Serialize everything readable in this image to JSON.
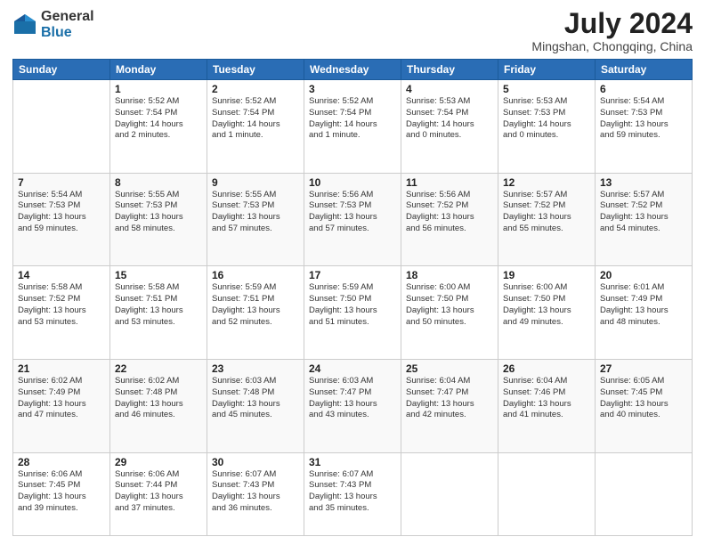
{
  "header": {
    "logo_general": "General",
    "logo_blue": "Blue",
    "month_title": "July 2024",
    "location": "Mingshan, Chongqing, China"
  },
  "days_of_week": [
    "Sunday",
    "Monday",
    "Tuesday",
    "Wednesday",
    "Thursday",
    "Friday",
    "Saturday"
  ],
  "weeks": [
    [
      {
        "day": "",
        "info": ""
      },
      {
        "day": "1",
        "info": "Sunrise: 5:52 AM\nSunset: 7:54 PM\nDaylight: 14 hours\nand 2 minutes."
      },
      {
        "day": "2",
        "info": "Sunrise: 5:52 AM\nSunset: 7:54 PM\nDaylight: 14 hours\nand 1 minute."
      },
      {
        "day": "3",
        "info": "Sunrise: 5:52 AM\nSunset: 7:54 PM\nDaylight: 14 hours\nand 1 minute."
      },
      {
        "day": "4",
        "info": "Sunrise: 5:53 AM\nSunset: 7:54 PM\nDaylight: 14 hours\nand 0 minutes."
      },
      {
        "day": "5",
        "info": "Sunrise: 5:53 AM\nSunset: 7:53 PM\nDaylight: 14 hours\nand 0 minutes."
      },
      {
        "day": "6",
        "info": "Sunrise: 5:54 AM\nSunset: 7:53 PM\nDaylight: 13 hours\nand 59 minutes."
      }
    ],
    [
      {
        "day": "7",
        "info": "Sunrise: 5:54 AM\nSunset: 7:53 PM\nDaylight: 13 hours\nand 59 minutes."
      },
      {
        "day": "8",
        "info": "Sunrise: 5:55 AM\nSunset: 7:53 PM\nDaylight: 13 hours\nand 58 minutes."
      },
      {
        "day": "9",
        "info": "Sunrise: 5:55 AM\nSunset: 7:53 PM\nDaylight: 13 hours\nand 57 minutes."
      },
      {
        "day": "10",
        "info": "Sunrise: 5:56 AM\nSunset: 7:53 PM\nDaylight: 13 hours\nand 57 minutes."
      },
      {
        "day": "11",
        "info": "Sunrise: 5:56 AM\nSunset: 7:52 PM\nDaylight: 13 hours\nand 56 minutes."
      },
      {
        "day": "12",
        "info": "Sunrise: 5:57 AM\nSunset: 7:52 PM\nDaylight: 13 hours\nand 55 minutes."
      },
      {
        "day": "13",
        "info": "Sunrise: 5:57 AM\nSunset: 7:52 PM\nDaylight: 13 hours\nand 54 minutes."
      }
    ],
    [
      {
        "day": "14",
        "info": "Sunrise: 5:58 AM\nSunset: 7:52 PM\nDaylight: 13 hours\nand 53 minutes."
      },
      {
        "day": "15",
        "info": "Sunrise: 5:58 AM\nSunset: 7:51 PM\nDaylight: 13 hours\nand 53 minutes."
      },
      {
        "day": "16",
        "info": "Sunrise: 5:59 AM\nSunset: 7:51 PM\nDaylight: 13 hours\nand 52 minutes."
      },
      {
        "day": "17",
        "info": "Sunrise: 5:59 AM\nSunset: 7:50 PM\nDaylight: 13 hours\nand 51 minutes."
      },
      {
        "day": "18",
        "info": "Sunrise: 6:00 AM\nSunset: 7:50 PM\nDaylight: 13 hours\nand 50 minutes."
      },
      {
        "day": "19",
        "info": "Sunrise: 6:00 AM\nSunset: 7:50 PM\nDaylight: 13 hours\nand 49 minutes."
      },
      {
        "day": "20",
        "info": "Sunrise: 6:01 AM\nSunset: 7:49 PM\nDaylight: 13 hours\nand 48 minutes."
      }
    ],
    [
      {
        "day": "21",
        "info": "Sunrise: 6:02 AM\nSunset: 7:49 PM\nDaylight: 13 hours\nand 47 minutes."
      },
      {
        "day": "22",
        "info": "Sunrise: 6:02 AM\nSunset: 7:48 PM\nDaylight: 13 hours\nand 46 minutes."
      },
      {
        "day": "23",
        "info": "Sunrise: 6:03 AM\nSunset: 7:48 PM\nDaylight: 13 hours\nand 45 minutes."
      },
      {
        "day": "24",
        "info": "Sunrise: 6:03 AM\nSunset: 7:47 PM\nDaylight: 13 hours\nand 43 minutes."
      },
      {
        "day": "25",
        "info": "Sunrise: 6:04 AM\nSunset: 7:47 PM\nDaylight: 13 hours\nand 42 minutes."
      },
      {
        "day": "26",
        "info": "Sunrise: 6:04 AM\nSunset: 7:46 PM\nDaylight: 13 hours\nand 41 minutes."
      },
      {
        "day": "27",
        "info": "Sunrise: 6:05 AM\nSunset: 7:45 PM\nDaylight: 13 hours\nand 40 minutes."
      }
    ],
    [
      {
        "day": "28",
        "info": "Sunrise: 6:06 AM\nSunset: 7:45 PM\nDaylight: 13 hours\nand 39 minutes."
      },
      {
        "day": "29",
        "info": "Sunrise: 6:06 AM\nSunset: 7:44 PM\nDaylight: 13 hours\nand 37 minutes."
      },
      {
        "day": "30",
        "info": "Sunrise: 6:07 AM\nSunset: 7:43 PM\nDaylight: 13 hours\nand 36 minutes."
      },
      {
        "day": "31",
        "info": "Sunrise: 6:07 AM\nSunset: 7:43 PM\nDaylight: 13 hours\nand 35 minutes."
      },
      {
        "day": "",
        "info": ""
      },
      {
        "day": "",
        "info": ""
      },
      {
        "day": "",
        "info": ""
      }
    ]
  ]
}
